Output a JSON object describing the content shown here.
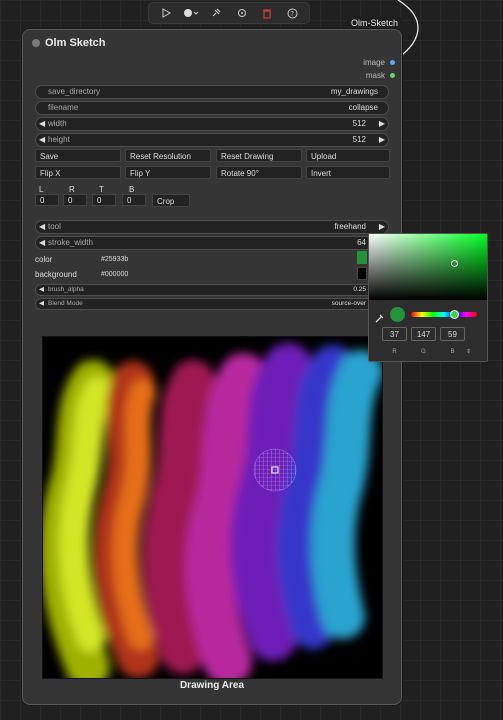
{
  "toolbar": {
    "icons": [
      "play-icon",
      "circle-dropdown-icon",
      "pin-icon",
      "target-icon",
      "trash-icon",
      "help-icon"
    ],
    "colors": {
      "trash": "#d13b3b"
    }
  },
  "node": {
    "badge": "Olm-Sketch",
    "title": "Olm Sketch",
    "outputs": [
      {
        "label": "image",
        "color": "#5fa8e8"
      },
      {
        "label": "mask",
        "color": "#6bd46b"
      }
    ],
    "save_directory": {
      "label": "save_directory",
      "value": "my_drawings"
    },
    "filename": {
      "label": "filename",
      "value": "collapse"
    },
    "width": {
      "label": "width",
      "value": "512"
    },
    "height": {
      "label": "height",
      "value": "512"
    },
    "buttons": {
      "save": "Save",
      "reset_resolution": "Reset Resolution",
      "reset_drawing": "Reset Drawing",
      "upload": "Upload",
      "flip_x": "Flip X",
      "flip_y": "Flip Y",
      "rotate": "Rotate 90°",
      "invert": "Invert",
      "crop": "Crop"
    },
    "crop_fields": [
      {
        "label": "L",
        "value": "0"
      },
      {
        "label": "R",
        "value": "0"
      },
      {
        "label": "T",
        "value": "0"
      },
      {
        "label": "B",
        "value": "0"
      }
    ],
    "tool": {
      "label": "tool",
      "value": "freehand"
    },
    "stroke_width": {
      "label": "stroke_width",
      "value": "64"
    },
    "color": {
      "label": "color",
      "value": "#25933b"
    },
    "background": {
      "label": "background",
      "value": "#000000"
    },
    "brush_alpha": {
      "label": "brush_alpha",
      "value": "0.25"
    },
    "blend_mode": {
      "label": "Blend Mode",
      "value": "source-over"
    },
    "canvas_label": "Drawing Area"
  },
  "picker": {
    "r": "37",
    "g": "147",
    "b": "59",
    "labels": [
      "R",
      "G",
      "B"
    ],
    "toggle_icon": "up-down-icon",
    "swatch_color": "#25933b"
  }
}
